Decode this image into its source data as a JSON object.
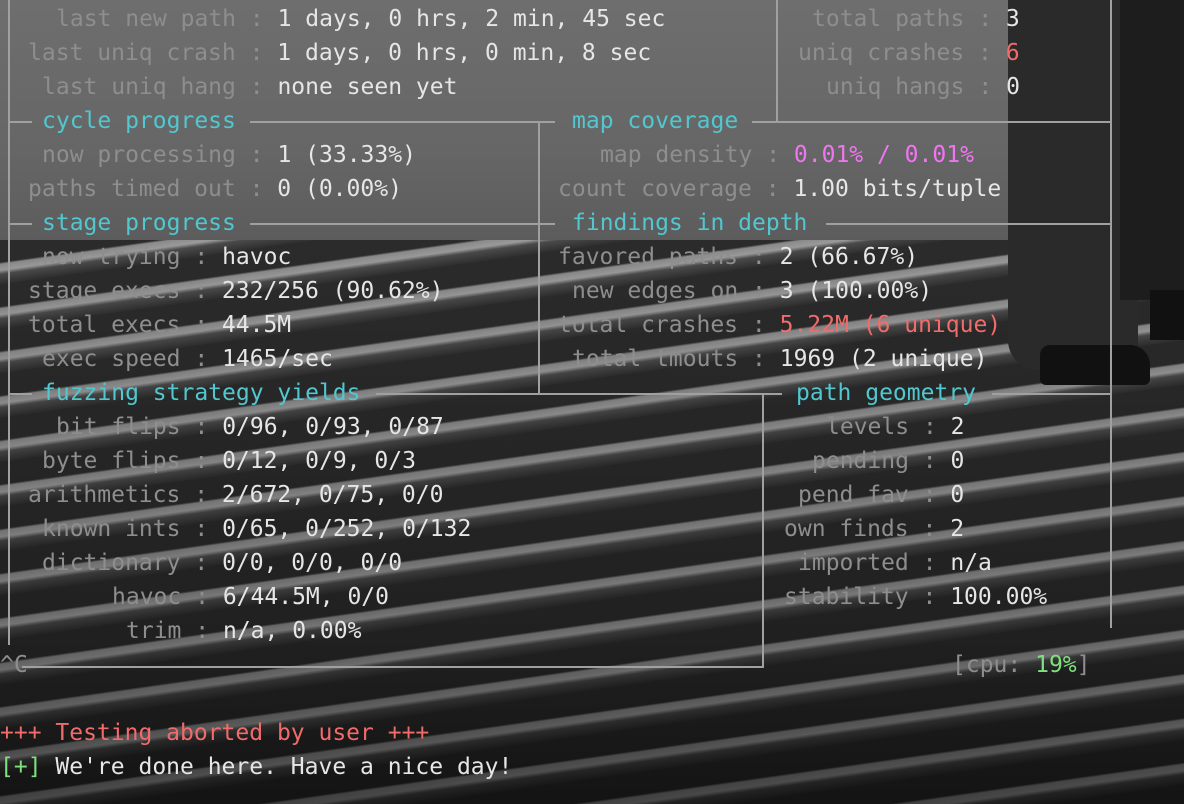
{
  "overall": {
    "last_new_path": {
      "label": "last new path",
      "value": "1 days, 0 hrs, 2 min, 45 sec"
    },
    "last_uniq_crash": {
      "label": "last uniq crash",
      "value": "1 days, 0 hrs, 0 min, 8 sec"
    },
    "last_uniq_hang": {
      "label": "last uniq hang",
      "value": "none seen yet"
    },
    "total_paths": {
      "label": "total paths",
      "value": "3"
    },
    "uniq_crashes": {
      "label": "uniq crashes",
      "value": "6"
    },
    "uniq_hangs": {
      "label": "uniq hangs",
      "value": "0"
    }
  },
  "cycle_progress": {
    "title": "cycle progress",
    "now_processing": {
      "label": "now processing",
      "value": "1 (33.33%)"
    },
    "paths_timed_out": {
      "label": "paths timed out",
      "value": "0 (0.00%)"
    }
  },
  "map_coverage": {
    "title": "map coverage",
    "map_density": {
      "label": "map density",
      "value": "0.01% / 0.01%"
    },
    "count_coverage": {
      "label": "count coverage",
      "value": "1.00 bits/tuple"
    }
  },
  "stage_progress": {
    "title": "stage progress",
    "now_trying": {
      "label": "now trying",
      "value": "havoc"
    },
    "stage_execs": {
      "label": "stage execs",
      "value": "232/256 (90.62%)"
    },
    "total_execs": {
      "label": "total execs",
      "value": "44.5M"
    },
    "exec_speed": {
      "label": "exec speed",
      "value": "1465/sec"
    }
  },
  "findings": {
    "title": "findings in depth",
    "favored_paths": {
      "label": "favored paths",
      "value": "2 (66.67%)"
    },
    "new_edges_on": {
      "label": "new edges on",
      "value": "3 (100.00%)"
    },
    "total_crashes": {
      "label": "total crashes",
      "value": "5.22M (6 unique)"
    },
    "total_tmouts": {
      "label": "total tmouts",
      "value": "1969 (2 unique)"
    }
  },
  "strategy": {
    "title": "fuzzing strategy yields",
    "bit_flips": {
      "label": "bit flips",
      "value": "0/96, 0/93, 0/87"
    },
    "byte_flips": {
      "label": "byte flips",
      "value": "0/12, 0/9, 0/3"
    },
    "arithmetics": {
      "label": "arithmetics",
      "value": "2/672, 0/75, 0/0"
    },
    "known_ints": {
      "label": "known ints",
      "value": "0/65, 0/252, 0/132"
    },
    "dictionary": {
      "label": "dictionary",
      "value": "0/0, 0/0, 0/0"
    },
    "havoc": {
      "label": "havoc",
      "value": "6/44.5M, 0/0"
    },
    "trim": {
      "label": "trim",
      "value": "n/a, 0.00%"
    }
  },
  "geometry": {
    "title": "path geometry",
    "levels": {
      "label": "levels",
      "value": "2"
    },
    "pending": {
      "label": "pending",
      "value": "0"
    },
    "pend_fav": {
      "label": "pend fav",
      "value": "0"
    },
    "own_finds": {
      "label": "own finds",
      "value": "2"
    },
    "imported": {
      "label": "imported",
      "value": "n/a"
    },
    "stability": {
      "label": "stability",
      "value": "100.00%"
    }
  },
  "cpu": {
    "label": "cpu:",
    "value": "19%"
  },
  "interrupt": "^C",
  "footer": {
    "aborted": "+++ Testing aborted by user +++",
    "done_prefix": "[+]",
    "done_text": " We're done here. Have a nice day!"
  },
  "sep": ":",
  "colors": {
    "cyan": "#52c7cf",
    "red": "#f26b6b",
    "magenta": "#f075f0",
    "green": "#7fe07f"
  }
}
